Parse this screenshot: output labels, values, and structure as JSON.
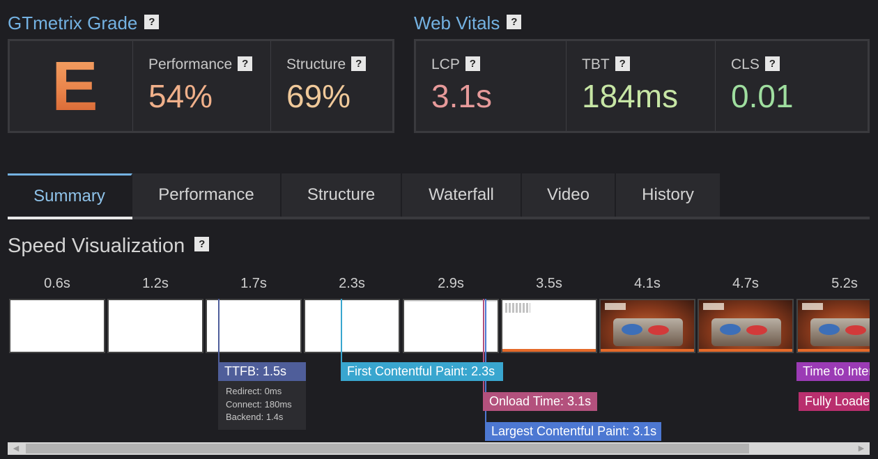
{
  "grade_section": {
    "title": "GTmetrix Grade",
    "help": "?",
    "grade": "E",
    "performance": {
      "label": "Performance",
      "value": "54%",
      "color": "#f0b08a"
    },
    "structure": {
      "label": "Structure",
      "value": "69%",
      "color": "#f0c99a"
    }
  },
  "vitals_section": {
    "title": "Web Vitals",
    "help": "?",
    "lcp": {
      "label": "LCP",
      "value": "3.1s",
      "color": "#e79a9a"
    },
    "tbt": {
      "label": "TBT",
      "value": "184ms",
      "color": "#c7e6a5"
    },
    "cls": {
      "label": "CLS",
      "value": "0.01",
      "color": "#9fde9f"
    }
  },
  "tabs": [
    {
      "label": "Summary",
      "active": true
    },
    {
      "label": "Performance",
      "active": false
    },
    {
      "label": "Structure",
      "active": false
    },
    {
      "label": "Waterfall",
      "active": false
    },
    {
      "label": "Video",
      "active": false
    },
    {
      "label": "History",
      "active": false
    }
  ],
  "speed_visualization": {
    "title": "Speed Visualization",
    "help": "?",
    "times": [
      "0.6s",
      "1.2s",
      "1.7s",
      "2.3s",
      "2.9s",
      "3.5s",
      "4.1s",
      "4.7s",
      "5.2s"
    ],
    "frames": [
      "blank",
      "blank",
      "blank",
      "blank",
      "blank-thin",
      "loading",
      "loaded",
      "loaded",
      "loaded"
    ],
    "markers": {
      "ttfb": {
        "label": "TTFB: 1.5s",
        "color": "#4f5e9a"
      },
      "fcp": {
        "label": "First Contentful Paint: 2.3s",
        "color": "#39a6cf"
      },
      "onload": {
        "label": "Onload Time: 3.1s",
        "color": "#b3517d"
      },
      "lcp": {
        "label": "Largest Contentful Paint: 3.1s",
        "color": "#4d78d2"
      },
      "tti": {
        "label": "Time to Interactive",
        "color": "#9b3bb5"
      },
      "fully_loaded": {
        "label": "Fully Loaded",
        "color": "#b92f6e"
      }
    },
    "ttfb_details": {
      "redirect": "Redirect: 0ms",
      "connect": "Connect: 180ms",
      "backend": "Backend: 1.4s"
    }
  },
  "scrollbar": {
    "left_arrow": "◀",
    "right_arrow": "▶"
  }
}
